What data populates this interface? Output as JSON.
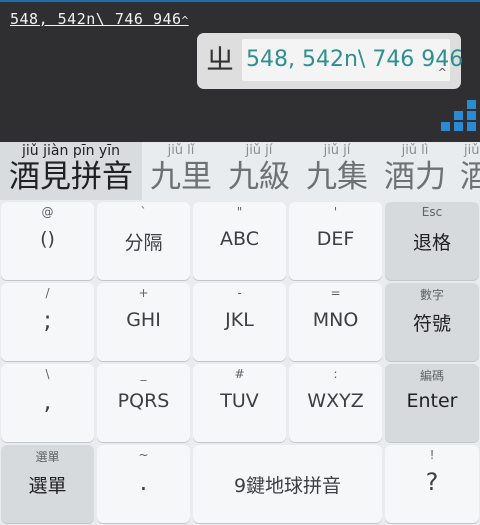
{
  "editor": {
    "input_text": "548, 542n\\ 746 946",
    "caret": "^"
  },
  "popup": {
    "icon_glyph": "ㄓ",
    "value": "548, 542n\\ 746 946",
    "caret": "^"
  },
  "candidates": [
    {
      "pinyin": "jiǔ jiàn pīn yīn",
      "hanzi": "酒見拼音"
    },
    {
      "pinyin": "jiǔ lǐ",
      "hanzi": "九里"
    },
    {
      "pinyin": "jiǔ jí",
      "hanzi": "九級"
    },
    {
      "pinyin": "jiǔ jí",
      "hanzi": "九集"
    },
    {
      "pinyin": "jiǔ lì",
      "hanzi": "酒力"
    },
    {
      "pinyin": "jiǔ",
      "hanzi": "酒"
    }
  ],
  "keys": {
    "r1": [
      {
        "hint": "@",
        "label": "()"
      },
      {
        "hint": "`",
        "label": "分隔"
      },
      {
        "hint": "\"",
        "label": "ABC"
      },
      {
        "hint": "'",
        "label": "DEF"
      },
      {
        "hint": "Esc",
        "label": "退格"
      }
    ],
    "r2": [
      {
        "hint": "/",
        "label": ";"
      },
      {
        "hint": "+",
        "label": "GHI"
      },
      {
        "hint": "-",
        "label": "JKL"
      },
      {
        "hint": "=",
        "label": "MNO"
      },
      {
        "hint": "數字",
        "label": "符號"
      }
    ],
    "r3": [
      {
        "hint": "\\",
        "label": ","
      },
      {
        "hint": "_",
        "label": "PQRS"
      },
      {
        "hint": "#",
        "label": "TUV"
      },
      {
        "hint": ":",
        "label": "WXYZ"
      },
      {
        "hint": "編碼",
        "label": "Enter"
      }
    ],
    "r4": [
      {
        "hint": "選單",
        "label": "選單"
      },
      {
        "hint": "~",
        "label": "."
      },
      {
        "hint": "",
        "label": "9鍵地球拼音"
      },
      {
        "hint": "!",
        "label": "?"
      }
    ]
  },
  "colors": {
    "accent": "#2a8bd4",
    "popup_text": "#2d8f8f",
    "topbar_bg": "#2f2f31"
  }
}
